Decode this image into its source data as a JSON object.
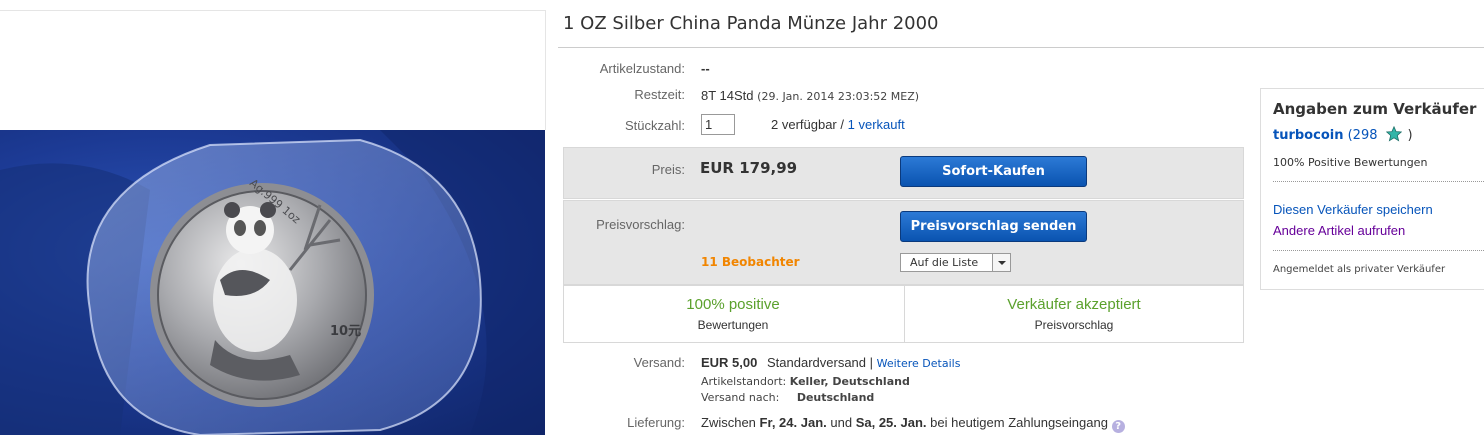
{
  "listing": {
    "title": "1 OZ Silber China Panda Münze Jahr 2000"
  },
  "details": {
    "condition_label": "Artikelzustand:",
    "condition_value": "--",
    "time_label": "Restzeit:",
    "time_value": "8T 14Std",
    "time_end": "(29. Jan. 2014  23:03:52 MEZ)",
    "qty_label": "Stückzahl:",
    "qty_value": "1",
    "available": "2 verfügbar /",
    "sold_link": "1 verkauft"
  },
  "buy": {
    "price_label": "Preis:",
    "price": "EUR 179,99",
    "buy_now_button": "Sofort-Kaufen",
    "offer_label": "Preisvorschlag:",
    "offer_button": "Preisvorschlag senden",
    "watchers": "11 Beobachter",
    "watch_dropdown": "Auf die Liste"
  },
  "feedback": {
    "positive_big": "100% positive",
    "positive_small": "Bewertungen",
    "offer_big": "Verkäufer akzeptiert",
    "offer_small": "Preisvorschlag"
  },
  "shipping": {
    "label": "Versand:",
    "cost": "EUR 5,00",
    "method": "Standardversand |",
    "details_link": "Weitere Details",
    "location_label": "Artikelstandort:",
    "location_value": "Keller, Deutschland",
    "ship_to_label": "Versand nach:",
    "ship_to_value": "Deutschland"
  },
  "delivery": {
    "label": "Lieferung:",
    "prefix": "Zwischen",
    "date1": "Fr, 24. Jan.",
    "and": "und",
    "date2": "Sa, 25. Jan.",
    "suffix": "bei heutigem Zahlungseingang",
    "info_icon": "?"
  },
  "seller": {
    "heading": "Angaben zum Verkäufer",
    "name": "turbocoin",
    "score_open": "(298",
    "score_close": ")",
    "positive": "100% Positive Bewertungen",
    "save_link": "Diesen Verkäufer speichern",
    "other_link": "Andere Artikel aufrufen",
    "registered": "Angemeldet als privater Verkäufer"
  },
  "coin_image": {
    "inscription_top": "Ag.999 1oz",
    "denomination": "10元"
  },
  "colors": {
    "link": "#0654ba",
    "visited_link": "#660099",
    "positive_green": "#5ba12d",
    "watchers_orange": "#f18500",
    "button_blue": "#0a53b0"
  }
}
